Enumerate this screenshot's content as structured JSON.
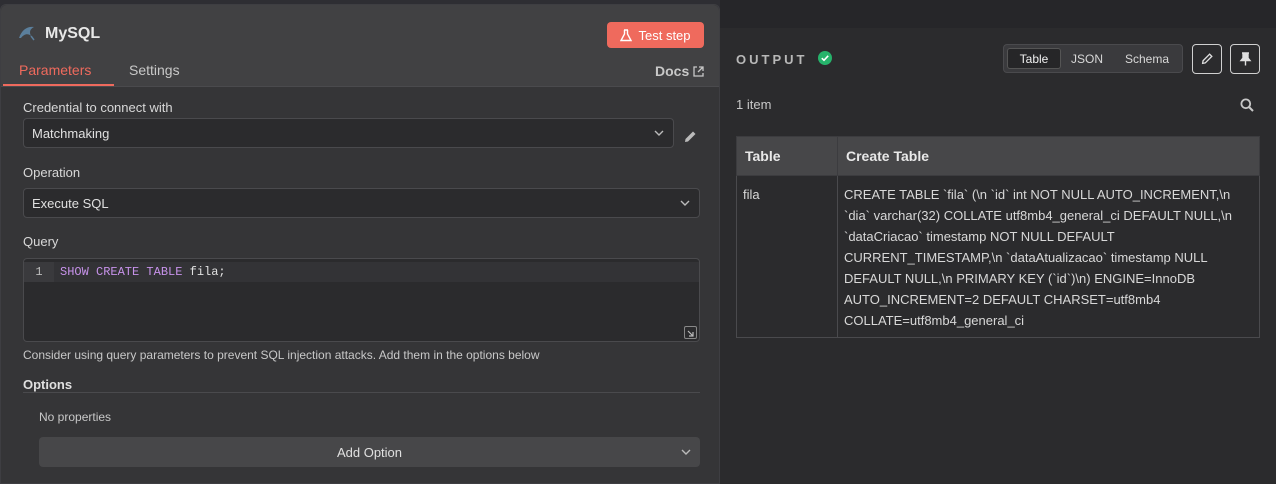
{
  "node": {
    "title": "MySQL",
    "test_step_label": "Test step",
    "tabs": [
      {
        "label": "Parameters"
      },
      {
        "label": "Settings"
      }
    ],
    "docs_label": "Docs",
    "credential": {
      "label": "Credential to connect with",
      "value": "Matchmaking"
    },
    "operation": {
      "label": "Operation",
      "value": "Execute SQL"
    },
    "query": {
      "label": "Query",
      "line_number": "1",
      "keyword": "SHOW CREATE TABLE",
      "argument": " fila;"
    },
    "hint": "Consider using query parameters to prevent SQL injection attacks. Add them in the options below",
    "options": {
      "label": "Options",
      "empty_text": "No properties",
      "add_label": "Add Option"
    }
  },
  "output": {
    "title": "OUTPUT",
    "views": [
      {
        "label": "Table",
        "active": true
      },
      {
        "label": "JSON",
        "active": false
      },
      {
        "label": "Schema",
        "active": false
      }
    ],
    "count": "1 item",
    "table": {
      "columns": [
        "Table",
        "Create Table"
      ],
      "rows": [
        [
          "fila",
          "CREATE TABLE `fila` (\\n  `id` int NOT NULL AUTO_INCREMENT,\\n  `dia` varchar(32) COLLATE utf8mb4_general_ci DEFAULT NULL,\\n  `dataCriacao` timestamp NOT NULL DEFAULT CURRENT_TIMESTAMP,\\n  `dataAtualizacao` timestamp NULL DEFAULT NULL,\\n  PRIMARY KEY (`id`)\\n) ENGINE=InnoDB AUTO_INCREMENT=2 DEFAULT CHARSET=utf8mb4 COLLATE=utf8mb4_general_ci"
        ]
      ]
    }
  },
  "colors": {
    "accent": "#ef6a5d",
    "success": "#26b36b"
  },
  "icons": {
    "node": "mysql-dolphin-icon",
    "test": "flask-icon",
    "docs": "external-link-icon",
    "edit": "pencil-icon",
    "pin": "pin-icon",
    "search": "search-icon",
    "status": "check-circle-icon"
  }
}
